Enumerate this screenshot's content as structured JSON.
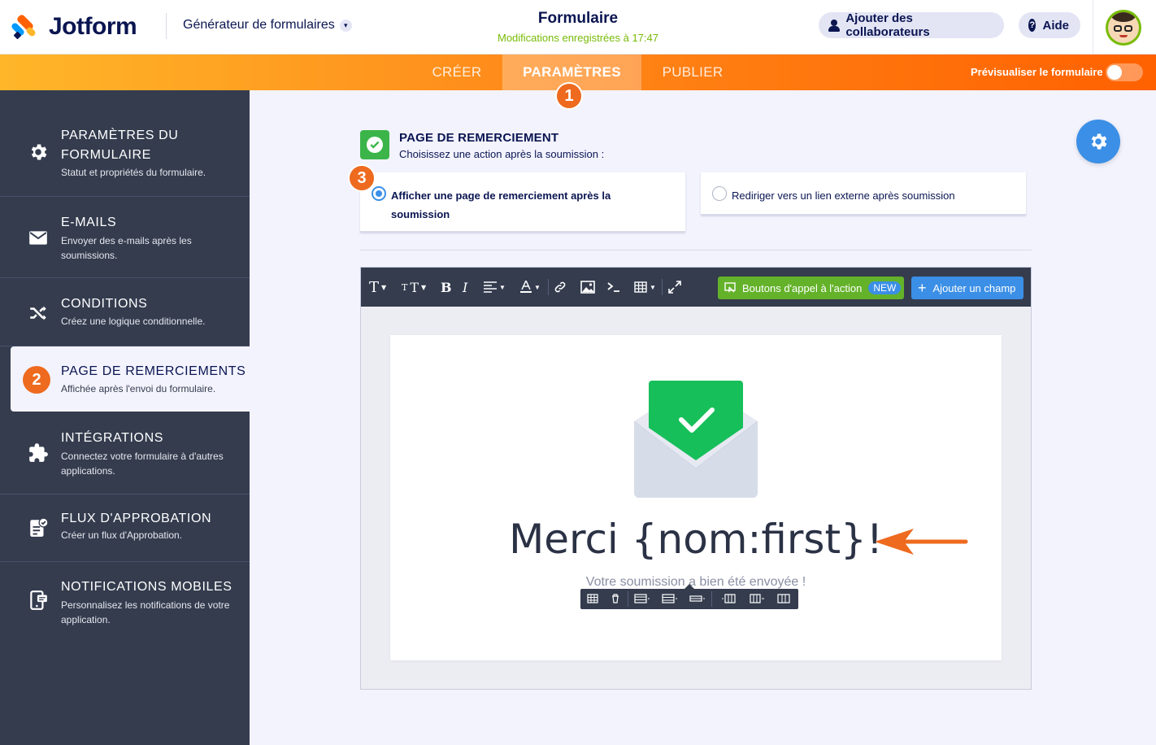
{
  "header": {
    "logo_text": "Jotform",
    "builder_switch": "Générateur de formulaires",
    "form_title": "Formulaire",
    "save_status": "Modifications enregistrées à 17:47",
    "collab_button": "Ajouter des collaborateurs",
    "help_button": "Aide"
  },
  "nav": {
    "tabs": [
      "CRÉER",
      "PARAMÈTRES",
      "PUBLIER"
    ],
    "active_tab": "PARAMÈTRES",
    "preview_label": "Prévisualiser le formulaire",
    "preview_enabled": false
  },
  "markers": [
    "1",
    "2",
    "3"
  ],
  "sidebar": {
    "items": [
      {
        "title": "PARAMÈTRES DU FORMULAIRE",
        "title_l1": "PARAMÈTRES DU",
        "title_l2": "FORMULAIRE",
        "subtitle": "Statut et propriétés du formulaire.",
        "icon": "gear-icon"
      },
      {
        "title": "E-MAILS",
        "subtitle": "Envoyer des e-mails après les soumissions.",
        "icon": "envelope-icon"
      },
      {
        "title": "CONDITIONS",
        "subtitle": "Créez une logique conditionnelle.",
        "icon": "shuffle-icon"
      },
      {
        "title": "PAGE DE REMERCIEMENTS",
        "subtitle": "Affichée après l'envoi du formulaire.",
        "icon": "number-badge",
        "active": true
      },
      {
        "title": "INTÉGRATIONS",
        "subtitle": "Connectez votre formulaire à d'autres applications.",
        "icon": "puzzle-icon"
      },
      {
        "title": "FLUX D'APPROBATION",
        "subtitle": "Créer un flux d'Approbation.",
        "icon": "approval-icon"
      },
      {
        "title": "NOTIFICATIONS MOBILES",
        "subtitle": "Personnalisez les notifications de votre application.",
        "icon": "mobile-notification-icon"
      }
    ]
  },
  "thankyou": {
    "section_title": "PAGE DE REMERCIEMENT",
    "section_subtitle": "Choisissez une action après la soumission :",
    "option_show": "Afficher une page de remerciement après la soumission",
    "option_redirect": "Rediriger vers un lien externe après soumission",
    "selected_option": "option_show"
  },
  "editor": {
    "cta_button": "Boutons d'appel à l'action",
    "new_badge": "NEW",
    "add_field_button": "Ajouter un champ",
    "heading": "Merci {nom:first}!",
    "subheading": "Votre soumission a bien été envoyée !"
  },
  "colors": {
    "accent_orange": "#ff6100",
    "sidebar_bg": "#343c4e",
    "primary_blue": "#3b8fe6",
    "success_green": "#3bb54a",
    "save_green": "#78bb07",
    "marker_orange": "#ee6a1e"
  }
}
